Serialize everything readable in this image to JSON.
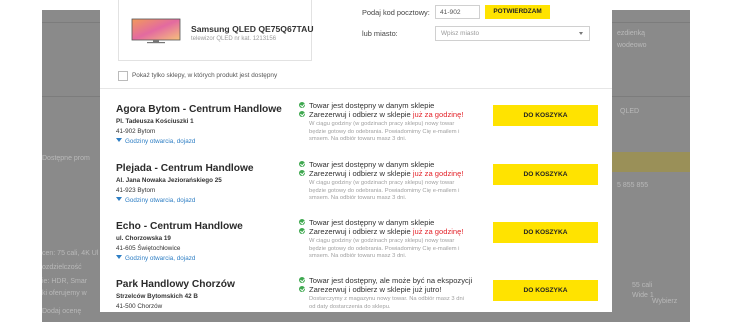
{
  "product": {
    "name": "Samsung QLED QE75Q67TAU",
    "subtitle": "telewizor QLED nr kat. 1213156"
  },
  "location": {
    "zip_label": "Podaj kod pocztowy:",
    "zip_value": "41-902",
    "confirm_label": "POTWIERDZAM",
    "city_label": "lub miasto:",
    "city_placeholder": "Wpisz miasto"
  },
  "filter": {
    "only_available_label": "Pokaż tylko sklepy, w których produkt jest dostępny"
  },
  "stores": [
    {
      "name": "Agora Bytom - Centrum Handlowe",
      "street": "Pl. Tadeusza Kościuszki 1",
      "city": "41-902 Bytom",
      "hours_link": "Godziny otwarcia, dojazd",
      "status1": "Towar jest dostępny w danym sklepie",
      "status2_prefix": "Zarezerwuj i odbierz w sklepie ",
      "status2_highlight": "już za godzinę!",
      "note1": "W ciągu godziny (w godzinach pracy sklepu) nowy towar",
      "note2": "będzie gotowy do odebrania. Powiadomimy Cię e-mailem i",
      "note3": "smsem. Na odbiór towaru masz 3 dni.",
      "cart_label": "DO KOSZYKA"
    },
    {
      "name": "Plejada - Centrum Handlowe",
      "street": "Al. Jana Nowaka Jeziorańskiego 25",
      "city": "41-923 Bytom",
      "hours_link": "Godziny otwarcia, dojazd",
      "status1": "Towar jest dostępny w danym sklepie",
      "status2_prefix": "Zarezerwuj i odbierz w sklepie ",
      "status2_highlight": "już za godzinę!",
      "note1": "W ciągu godziny (w godzinach pracy sklepu) nowy towar",
      "note2": "będzie gotowy do odebrania. Powiadomimy Cię e-mailem i",
      "note3": "smsem. Na odbiór towaru masz 3 dni.",
      "cart_label": "DO KOSZYKA"
    },
    {
      "name": "Echo - Centrum Handlowe",
      "street": "ul. Chorzowska 19",
      "city": "41-605 Świętochłowice",
      "hours_link": "Godziny otwarcia, dojazd",
      "status1": "Towar jest dostępny w danym sklepie",
      "status2_prefix": "Zarezerwuj i odbierz w sklepie ",
      "status2_highlight": "już za godzinę!",
      "note1": "W ciągu godziny (w godzinach pracy sklepu) nowy towar",
      "note2": "będzie gotowy do odebrania. Powiadomimy Cię e-mailem i",
      "note3": "smsem. Na odbiór towaru masz 3 dni.",
      "cart_label": "DO KOSZYKA"
    },
    {
      "name": "Park Handlowy Chorzów",
      "street": "Strzelców Bytomskich 42 B",
      "city": "41-500 Chorzów",
      "status1": "Towar jest dostępny, ale może być na ekspozycji",
      "status2_prefix": "Zarezerwuj i odbierz w sklepie już jutro!",
      "note1": "Dostarczymy z magazynu nowy towar. Na odbiór masz 3 dni",
      "note2": "od daty dostarczenia do sklepu.",
      "cart_label": "DO KOSZYKA"
    }
  ],
  "background": {
    "left_texts": [
      "Dostępne prom",
      "cen: 75 cali, 4K Ul",
      "ozdzielczość",
      "ie: HDR, Smar",
      "ki oferujemy w",
      "Dodaj ocenę"
    ],
    "right_texts": [
      "ezdienką",
      "wodeowo",
      "QLED",
      "5 855 855",
      "55 cali",
      "Wide 1",
      "Wybierz"
    ]
  },
  "colors": {
    "accent_yellow": "#ffe300",
    "link_blue": "#2d7ec4",
    "success_green": "#3ea84f",
    "highlight_red": "#e3242b"
  }
}
